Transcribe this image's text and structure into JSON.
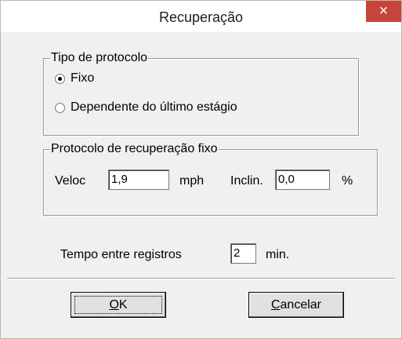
{
  "window": {
    "title": "Recuperação",
    "close_glyph": "×"
  },
  "protocol_type": {
    "legend": "Tipo de protocolo",
    "options": [
      {
        "label": "Fixo",
        "selected": true
      },
      {
        "label": "Dependente do último estágio",
        "selected": false
      }
    ]
  },
  "fixed_protocol": {
    "legend": "Protocolo de recuperação fixo",
    "speed_label": "Veloc",
    "speed_value": "1,9",
    "speed_unit": "mph",
    "incline_label": "Inclin.",
    "incline_value": "0,0",
    "incline_unit": "%"
  },
  "interval": {
    "label": "Tempo entre registros",
    "value": "2",
    "unit": "min."
  },
  "buttons": {
    "ok_mnemonic": "O",
    "ok_rest": "K",
    "cancel_mnemonic": "C",
    "cancel_rest": "ancelar"
  },
  "colors": {
    "close_button": "#c7443a",
    "dialog_bg": "#f0f0f0"
  }
}
